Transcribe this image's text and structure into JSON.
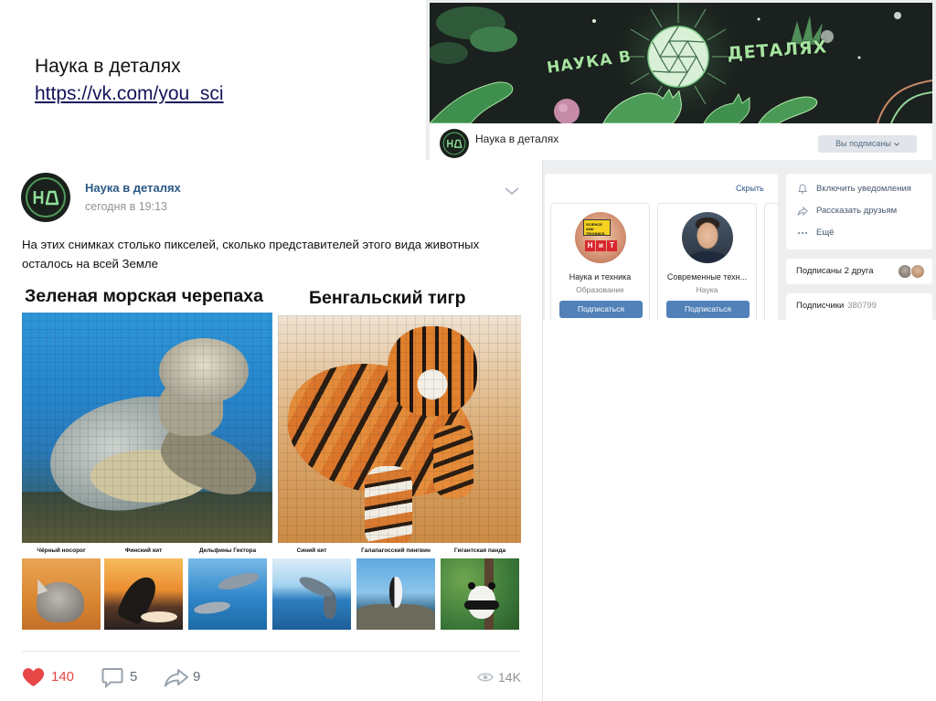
{
  "slide": {
    "title": "Наука в деталях",
    "link": "https://vk.com/you_sci"
  },
  "group_page": {
    "cover": {
      "title_left": "НАУКА В",
      "title_right": "ДЕТАЛЯХ"
    },
    "name": "Наука в деталях",
    "subscribed_button": "Вы подписаны"
  },
  "recommendations": {
    "hide_label": "Скрыть",
    "items": [
      {
        "name": "Наука и техника",
        "category": "Образование",
        "button": "Подписаться",
        "avatar_caption": "SCIENCE AND TECHNICS",
        "avatar_letters": [
          "Н",
          "и",
          "Т"
        ]
      },
      {
        "name": "Современные техн...",
        "category": "Наука",
        "button": "Подписаться"
      }
    ]
  },
  "sidebar": {
    "actions": [
      {
        "label": "Включить уведомления",
        "icon": "bell-icon"
      },
      {
        "label": "Рассказать друзьям",
        "icon": "share-icon"
      },
      {
        "label": "Ещё",
        "icon": "more-icon"
      }
    ],
    "friends_label": "Подписаны 2 друга",
    "followers_label": "Подписчики",
    "followers_count": "380799"
  },
  "post": {
    "author": "Наука в деталях",
    "time": "сегодня в 19:13",
    "text_lines": [
      "На этих снимках столько пикселей, сколько представителей этого вида животных",
      "осталось на всей Земле"
    ],
    "images": [
      {
        "caption": "Зеленая морская черепаха"
      },
      {
        "caption": "Бенгальский тигр"
      }
    ],
    "thumbnails": [
      "Чёрный носорог",
      "Финский кит",
      "Дельфины Гектора",
      "Синий кит",
      "Галапагосский пингвин",
      "Гигантская панда"
    ],
    "likes": "140",
    "comments": "5",
    "shares": "9",
    "views": "14K"
  },
  "colors": {
    "link": "#2a5885",
    "like": "#e64646",
    "button": "#5181b8",
    "muted": "#939393"
  }
}
